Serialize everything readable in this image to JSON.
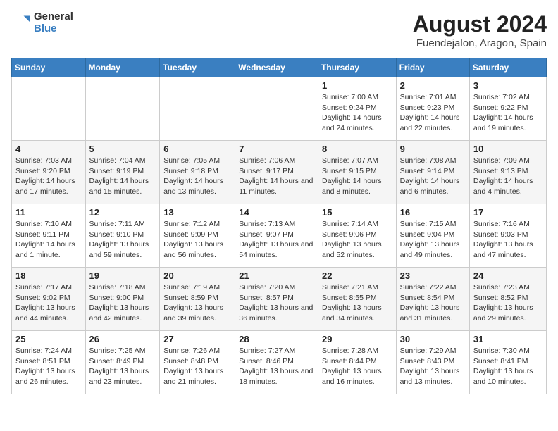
{
  "header": {
    "logo_line1": "General",
    "logo_line2": "Blue",
    "title": "August 2024",
    "subtitle": "Fuendejalon, Aragon, Spain"
  },
  "weekdays": [
    "Sunday",
    "Monday",
    "Tuesday",
    "Wednesday",
    "Thursday",
    "Friday",
    "Saturday"
  ],
  "weeks": [
    [
      {
        "day": "",
        "info": ""
      },
      {
        "day": "",
        "info": ""
      },
      {
        "day": "",
        "info": ""
      },
      {
        "day": "",
        "info": ""
      },
      {
        "day": "1",
        "info": "Sunrise: 7:00 AM\nSunset: 9:24 PM\nDaylight: 14 hours and 24 minutes."
      },
      {
        "day": "2",
        "info": "Sunrise: 7:01 AM\nSunset: 9:23 PM\nDaylight: 14 hours and 22 minutes."
      },
      {
        "day": "3",
        "info": "Sunrise: 7:02 AM\nSunset: 9:22 PM\nDaylight: 14 hours and 19 minutes."
      }
    ],
    [
      {
        "day": "4",
        "info": "Sunrise: 7:03 AM\nSunset: 9:20 PM\nDaylight: 14 hours and 17 minutes."
      },
      {
        "day": "5",
        "info": "Sunrise: 7:04 AM\nSunset: 9:19 PM\nDaylight: 14 hours and 15 minutes."
      },
      {
        "day": "6",
        "info": "Sunrise: 7:05 AM\nSunset: 9:18 PM\nDaylight: 14 hours and 13 minutes."
      },
      {
        "day": "7",
        "info": "Sunrise: 7:06 AM\nSunset: 9:17 PM\nDaylight: 14 hours and 11 minutes."
      },
      {
        "day": "8",
        "info": "Sunrise: 7:07 AM\nSunset: 9:15 PM\nDaylight: 14 hours and 8 minutes."
      },
      {
        "day": "9",
        "info": "Sunrise: 7:08 AM\nSunset: 9:14 PM\nDaylight: 14 hours and 6 minutes."
      },
      {
        "day": "10",
        "info": "Sunrise: 7:09 AM\nSunset: 9:13 PM\nDaylight: 14 hours and 4 minutes."
      }
    ],
    [
      {
        "day": "11",
        "info": "Sunrise: 7:10 AM\nSunset: 9:11 PM\nDaylight: 14 hours and 1 minute."
      },
      {
        "day": "12",
        "info": "Sunrise: 7:11 AM\nSunset: 9:10 PM\nDaylight: 13 hours and 59 minutes."
      },
      {
        "day": "13",
        "info": "Sunrise: 7:12 AM\nSunset: 9:09 PM\nDaylight: 13 hours and 56 minutes."
      },
      {
        "day": "14",
        "info": "Sunrise: 7:13 AM\nSunset: 9:07 PM\nDaylight: 13 hours and 54 minutes."
      },
      {
        "day": "15",
        "info": "Sunrise: 7:14 AM\nSunset: 9:06 PM\nDaylight: 13 hours and 52 minutes."
      },
      {
        "day": "16",
        "info": "Sunrise: 7:15 AM\nSunset: 9:04 PM\nDaylight: 13 hours and 49 minutes."
      },
      {
        "day": "17",
        "info": "Sunrise: 7:16 AM\nSunset: 9:03 PM\nDaylight: 13 hours and 47 minutes."
      }
    ],
    [
      {
        "day": "18",
        "info": "Sunrise: 7:17 AM\nSunset: 9:02 PM\nDaylight: 13 hours and 44 minutes."
      },
      {
        "day": "19",
        "info": "Sunrise: 7:18 AM\nSunset: 9:00 PM\nDaylight: 13 hours and 42 minutes."
      },
      {
        "day": "20",
        "info": "Sunrise: 7:19 AM\nSunset: 8:59 PM\nDaylight: 13 hours and 39 minutes."
      },
      {
        "day": "21",
        "info": "Sunrise: 7:20 AM\nSunset: 8:57 PM\nDaylight: 13 hours and 36 minutes."
      },
      {
        "day": "22",
        "info": "Sunrise: 7:21 AM\nSunset: 8:55 PM\nDaylight: 13 hours and 34 minutes."
      },
      {
        "day": "23",
        "info": "Sunrise: 7:22 AM\nSunset: 8:54 PM\nDaylight: 13 hours and 31 minutes."
      },
      {
        "day": "24",
        "info": "Sunrise: 7:23 AM\nSunset: 8:52 PM\nDaylight: 13 hours and 29 minutes."
      }
    ],
    [
      {
        "day": "25",
        "info": "Sunrise: 7:24 AM\nSunset: 8:51 PM\nDaylight: 13 hours and 26 minutes."
      },
      {
        "day": "26",
        "info": "Sunrise: 7:25 AM\nSunset: 8:49 PM\nDaylight: 13 hours and 23 minutes."
      },
      {
        "day": "27",
        "info": "Sunrise: 7:26 AM\nSunset: 8:48 PM\nDaylight: 13 hours and 21 minutes."
      },
      {
        "day": "28",
        "info": "Sunrise: 7:27 AM\nSunset: 8:46 PM\nDaylight: 13 hours and 18 minutes."
      },
      {
        "day": "29",
        "info": "Sunrise: 7:28 AM\nSunset: 8:44 PM\nDaylight: 13 hours and 16 minutes."
      },
      {
        "day": "30",
        "info": "Sunrise: 7:29 AM\nSunset: 8:43 PM\nDaylight: 13 hours and 13 minutes."
      },
      {
        "day": "31",
        "info": "Sunrise: 7:30 AM\nSunset: 8:41 PM\nDaylight: 13 hours and 10 minutes."
      }
    ]
  ]
}
